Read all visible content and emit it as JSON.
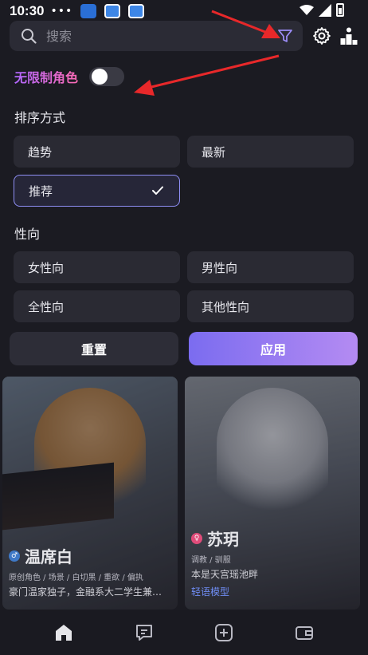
{
  "status_bar": {
    "time": "10:30",
    "dots": "•••"
  },
  "search": {
    "placeholder": "搜索"
  },
  "unlimited_role": {
    "label": "无限制角色",
    "enabled": false
  },
  "sort": {
    "title": "排序方式",
    "options": [
      "趋势",
      "最新",
      "推荐"
    ],
    "selected": "推荐"
  },
  "orientation": {
    "title": "性向",
    "options": [
      "女性向",
      "男性向",
      "全性向",
      "其他性向"
    ]
  },
  "actions": {
    "reset": "重置",
    "apply": "应用"
  },
  "cards": [
    {
      "name": "温席白",
      "gender": "male",
      "tags": "原创角色 / 场景 / 白切黑 / 重欲 / 偏执",
      "desc": "豪门温家独子，金融系大二学生兼…"
    },
    {
      "name": "苏玥",
      "gender": "female",
      "tags": "调教 / 驯服",
      "desc": "本是天宫瑶池畔",
      "model": "轻语模型"
    }
  ],
  "colors": {
    "accent": "#7b6cf0",
    "annotation_arrow": "#e8282a",
    "background": "#1b1b22"
  },
  "icons": [
    "search-icon",
    "filter-icon",
    "gear-icon",
    "leaderboard-icon",
    "home-icon",
    "chat-icon",
    "add-icon",
    "wallet-icon"
  ]
}
